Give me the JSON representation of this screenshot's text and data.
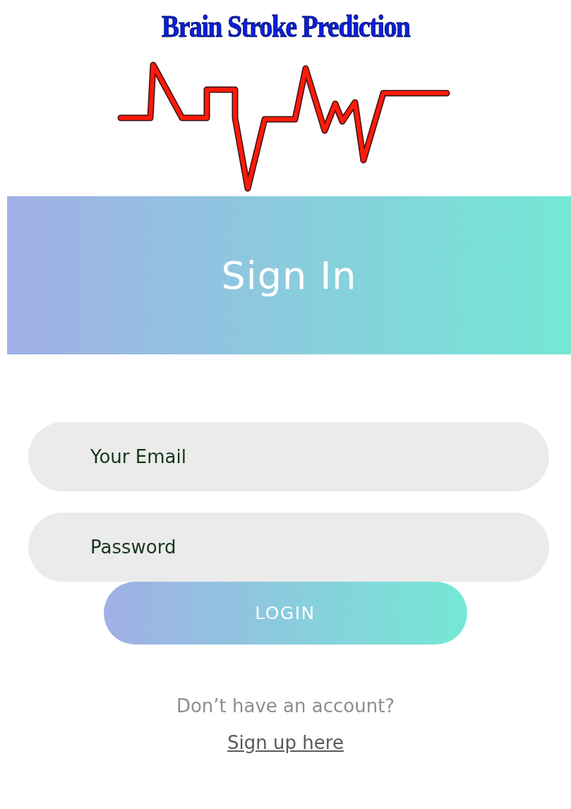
{
  "app_title": "Brain Stroke Prediction",
  "header": {
    "title": "Sign In"
  },
  "fields": [
    {
      "placeholder": "Your Email"
    },
    {
      "placeholder": "Password"
    }
  ],
  "login_button": {
    "label": "LOGIN"
  },
  "signup": {
    "prompt": "Don’t have an account?",
    "link": "Sign up here"
  }
}
